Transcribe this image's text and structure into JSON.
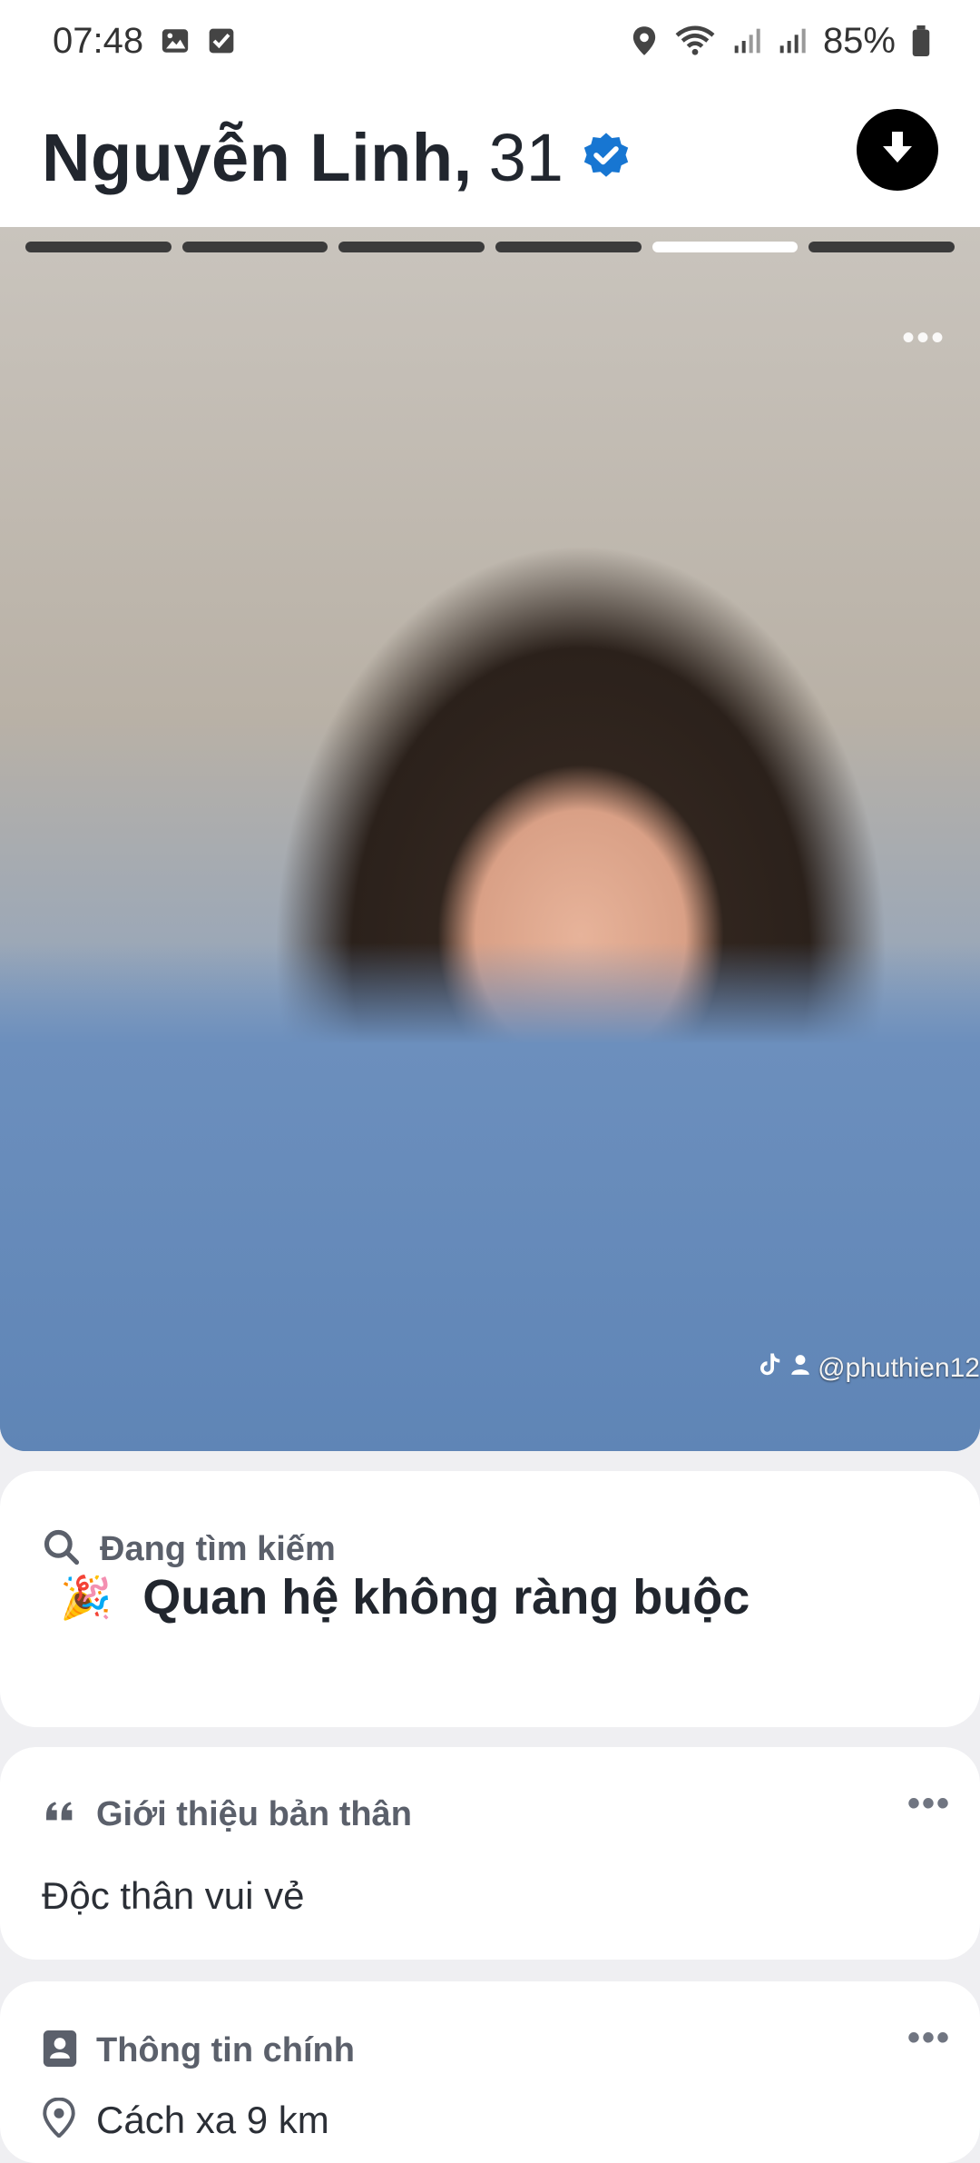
{
  "status_bar": {
    "time": "07:48",
    "battery": "85%",
    "icons": [
      "gallery-icon",
      "checkbox-icon",
      "location-icon",
      "wifi-icon",
      "signal-icon",
      "signal-icon",
      "battery-icon"
    ]
  },
  "profile": {
    "name": "Nguyễn Linh,",
    "age": "31",
    "verified": true,
    "accent_color": "#1776d2"
  },
  "photo": {
    "segments_total": 6,
    "active_segment": 5,
    "watermark": "@phuthien12"
  },
  "looking_for": {
    "title": "Đang tìm kiếm",
    "emoji": "🎉",
    "value": "Quan hệ không ràng buộc"
  },
  "about": {
    "title": "Giới thiệu bản thân",
    "text": "Độc thân vui vẻ",
    "more": "•••"
  },
  "main_info": {
    "title": "Thông tin chính",
    "distance": "Cách xa 9 km",
    "more": "•••"
  }
}
